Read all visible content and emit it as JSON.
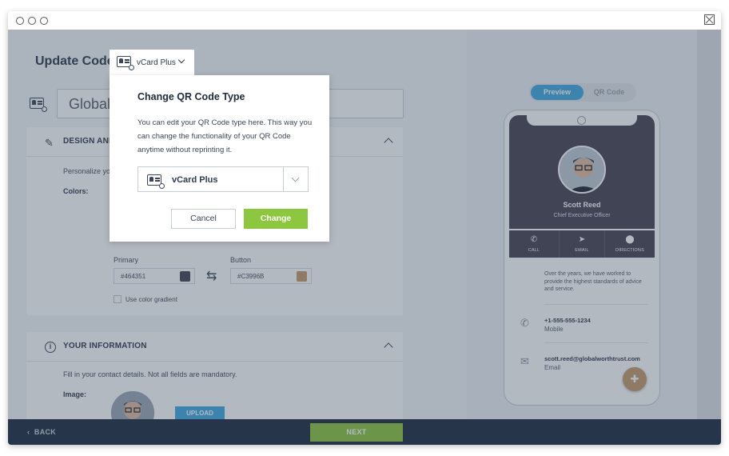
{
  "window": {
    "controls": [
      "dot",
      "dot",
      "dot"
    ]
  },
  "header": {
    "title": "Update Code",
    "type_tab_label": "vCard Plus"
  },
  "name_input": {
    "value": "Global"
  },
  "design_panel": {
    "title": "DESIGN AND",
    "description": "Personalize yo",
    "colors_label": "Colors:",
    "primary_label": "Primary",
    "primary_value": "#464351",
    "button_label": "Button",
    "button_value": "#C3996B",
    "gradient_label": "Use color gradient"
  },
  "info_panel": {
    "title": "YOUR INFORMATION",
    "description": "Fill in your contact details. Not all fields are mandatory.",
    "image_label": "Image:",
    "upload_label": "UPLOAD"
  },
  "footer": {
    "back_label": "BACK",
    "next_label": "NEXT"
  },
  "preview_toggle": {
    "preview_label": "Preview",
    "qr_label": "QR Code"
  },
  "phone": {
    "name": "Scott Reed",
    "title": "Chief Executive Officer",
    "actions": [
      {
        "label": "CALL",
        "icon": "phone-icon"
      },
      {
        "label": "EMAIL",
        "icon": "send-icon"
      },
      {
        "label": "DIRECTIONS",
        "icon": "location-icon"
      }
    ],
    "about": "Over the years, we have worked to provide the highest standards of advice and service.",
    "phone_number": "+1-555-555-1234",
    "phone_type": "Mobile",
    "email": "scott.reed@globalworthtrust.com",
    "email_type": "Email"
  },
  "modal": {
    "title": "Change QR Code Type",
    "description": "You can edit your QR Code type here. This way you can change the functionality of your QR Code anytime without reprinting it.",
    "select_value": "vCard Plus",
    "cancel_label": "Cancel",
    "change_label": "Change"
  },
  "colors": {
    "primary": "#464351",
    "button": "#C3996B",
    "accent_blue": "#3fa9e0",
    "accent_green": "#8dc63f",
    "footer": "#1c2a3e"
  }
}
